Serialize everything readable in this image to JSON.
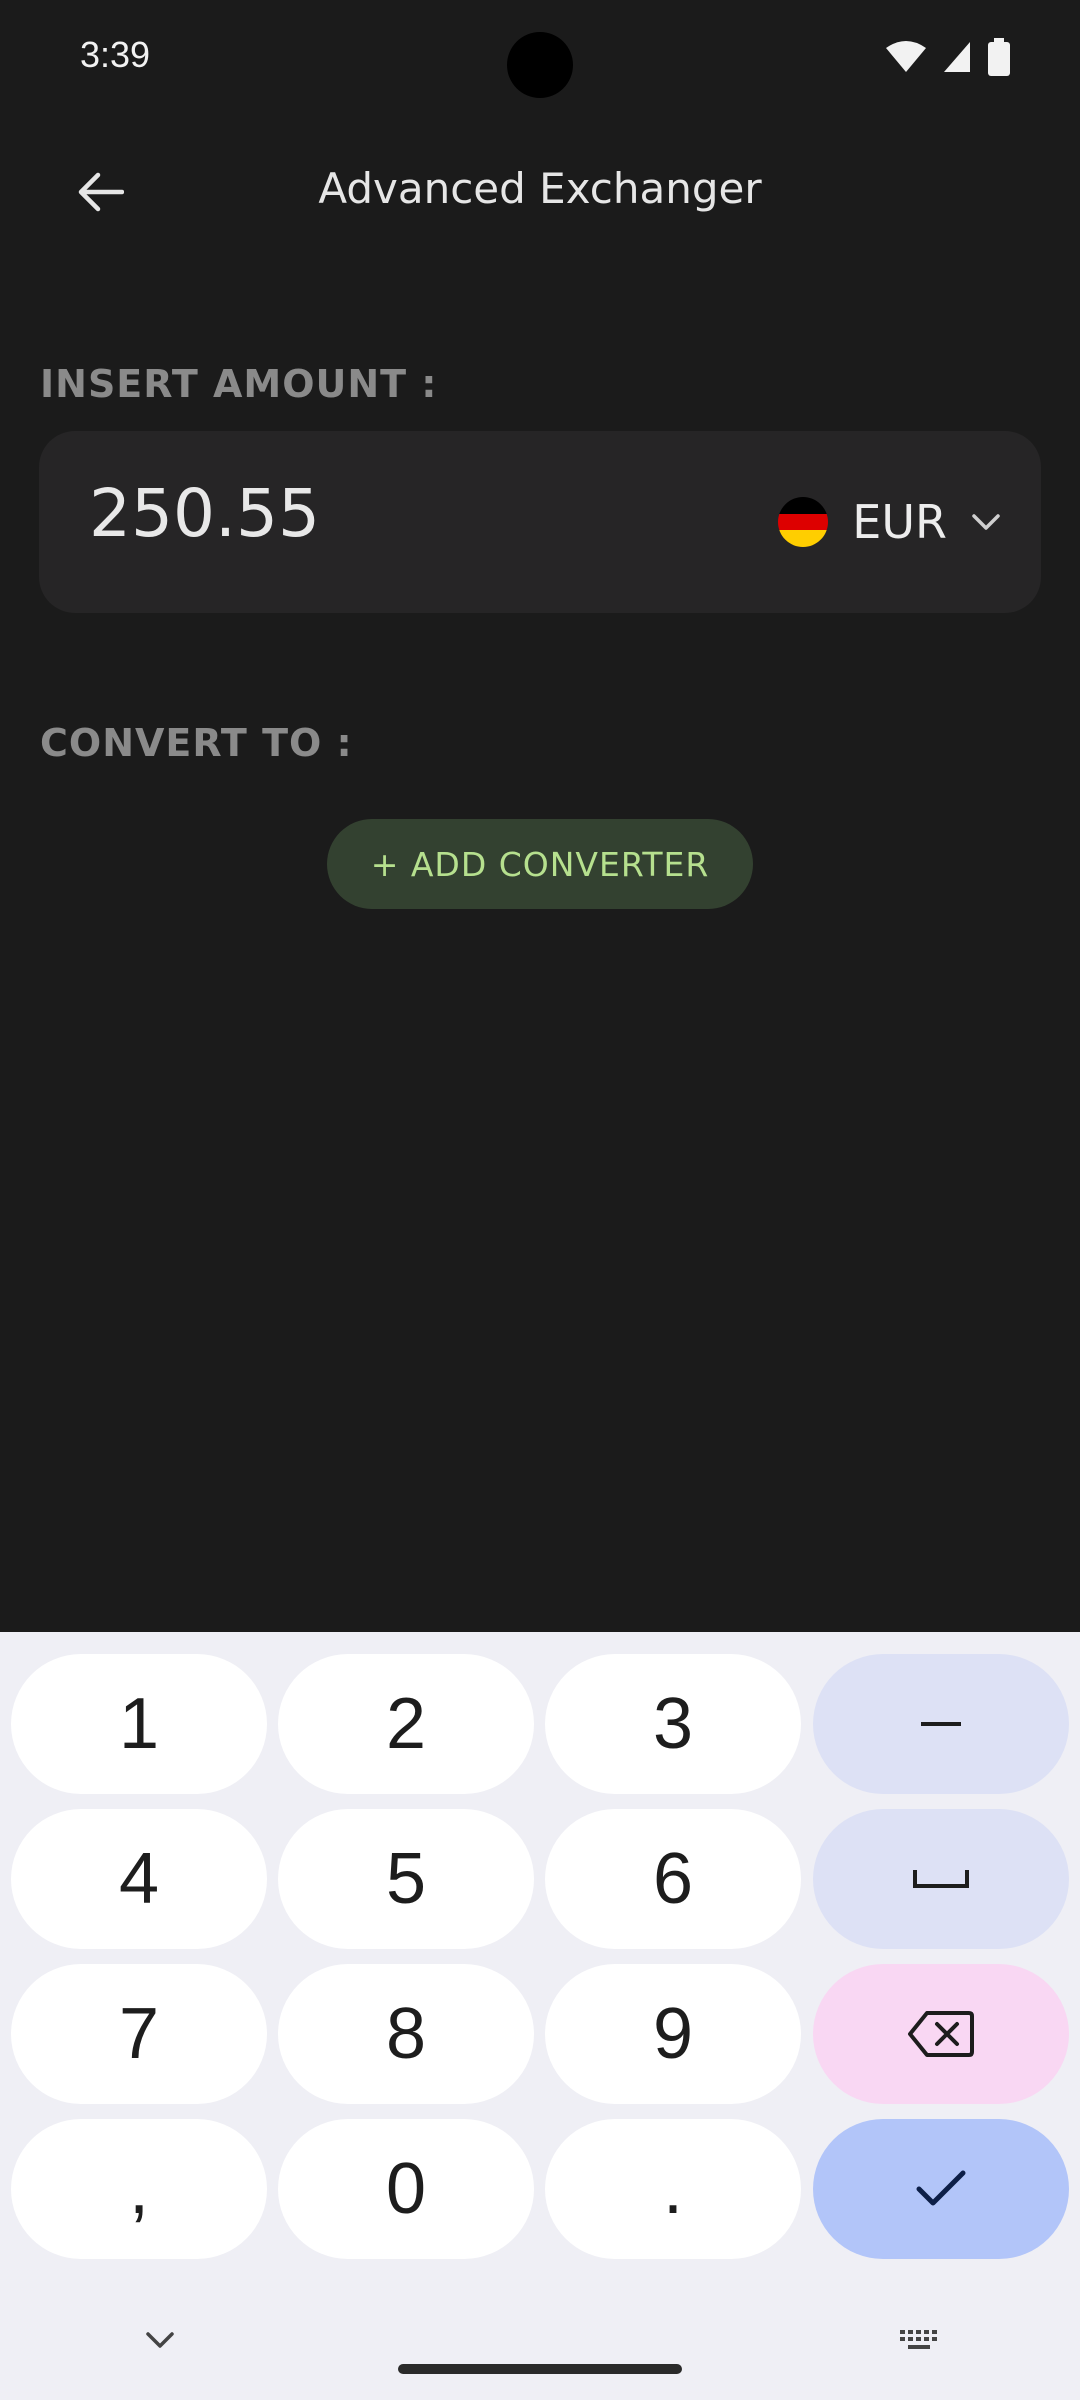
{
  "status": {
    "time": "3:39"
  },
  "header": {
    "title": "Advanced Exchanger"
  },
  "amount_section": {
    "label": "INSERT AMOUNT :",
    "value": "250.55",
    "currency": "EUR"
  },
  "convert_section": {
    "label": "CONVERT TO :",
    "add_button": "+ ADD CONVERTER"
  },
  "keyboard": {
    "keys": [
      "1",
      "2",
      "3",
      "–",
      "4",
      "5",
      "6",
      "␣",
      "7",
      "8",
      "9",
      "⌫",
      ",",
      "0",
      ".",
      "✓"
    ]
  },
  "colors": {
    "background": "#1b1b1b",
    "card": "#262526",
    "accent_button_bg": "#334130",
    "accent_button_text": "#b6e08e"
  }
}
